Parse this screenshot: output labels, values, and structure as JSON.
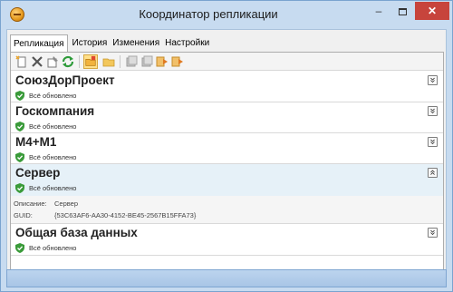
{
  "window": {
    "title": "Координатор репликации",
    "minimize_label": "–",
    "close_label": "✕"
  },
  "tabs": [
    "Репликация",
    "История",
    "Изменения",
    "Настройки"
  ],
  "toolbar_icons": [
    "new-icon",
    "delete-icon",
    "properties-icon",
    "refresh-icon",
    "sync-folder-icon",
    "folder-icon",
    "export-icon",
    "import-icon",
    "send-icon",
    "receive-icon"
  ],
  "items": [
    {
      "name": "СоюзДорПроект",
      "status": "Всё обновлено"
    },
    {
      "name": "Госкомпания",
      "status": "Всё обновлено"
    },
    {
      "name": "М4+М1",
      "status": "Всё обновлено"
    },
    {
      "name": "Сервер",
      "status": "Всё обновлено"
    },
    {
      "name": "Общая база данных",
      "status": "Всё обновлено"
    }
  ],
  "details": {
    "description_label": "Описание:",
    "description_value": "Сервер",
    "guid_label": "GUID:",
    "guid_value": "{53C63AF6-AA30-4152-BE45-2567B15FFA73}"
  },
  "colors": {
    "selected_row": "#e6f1f8",
    "status_ok": "#3a9b3a",
    "close_button": "#c7443c"
  }
}
